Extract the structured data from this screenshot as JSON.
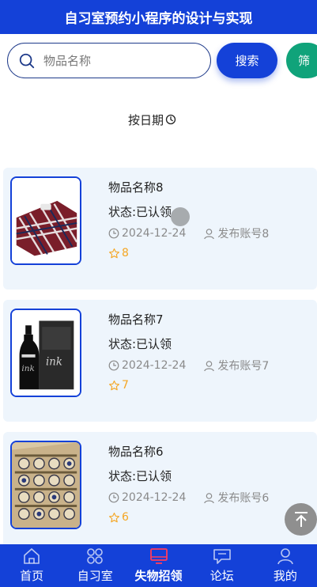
{
  "header": {
    "title": "自习室预约小程序的设计与实现"
  },
  "search": {
    "placeholder": "物品名称",
    "button_label": "搜索",
    "filter_label": "筛"
  },
  "sort": {
    "label": "按日期"
  },
  "items": [
    {
      "name": "物品名称8",
      "status": "状态:已认领",
      "date": "2024-12-24",
      "author": "发布账号8",
      "stars": "8",
      "image": "plaid-blanket"
    },
    {
      "name": "物品名称7",
      "status": "状态:已认领",
      "date": "2024-12-24",
      "author": "发布账号7",
      "stars": "7",
      "image": "black-bottle"
    },
    {
      "name": "物品名称6",
      "status": "状态:已认领",
      "date": "2024-12-24",
      "author": "发布账号6",
      "stars": "6",
      "image": "watch-box"
    }
  ],
  "tabbar": [
    {
      "label": "首页",
      "icon": "home-icon",
      "active": false
    },
    {
      "label": "自习室",
      "icon": "grid-icon",
      "active": false
    },
    {
      "label": "失物招领",
      "icon": "monitor-icon",
      "active": true
    },
    {
      "label": "论坛",
      "icon": "chat-icon",
      "active": false
    },
    {
      "label": "我的",
      "icon": "user-icon",
      "active": false
    }
  ],
  "colors": {
    "primary": "#1441d8",
    "filter": "#10a37a",
    "card_bg": "#eef5fc",
    "star": "#f5a623",
    "active_tab_icon": "#ff3b5c"
  }
}
